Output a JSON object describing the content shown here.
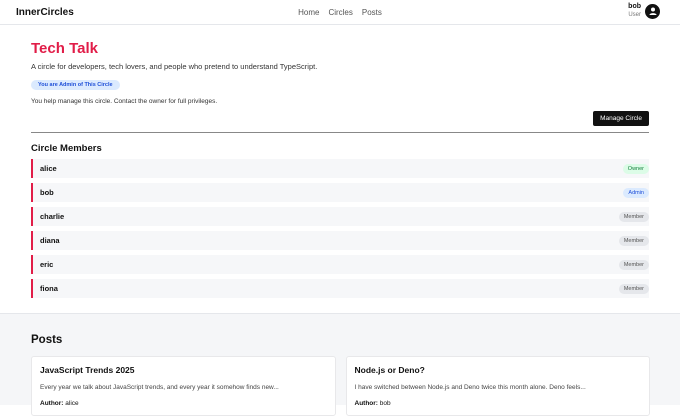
{
  "header": {
    "brand": "InnerCircles",
    "nav": [
      "Home",
      "Circles",
      "Posts"
    ],
    "user": {
      "name": "bob",
      "role": "User"
    }
  },
  "circle": {
    "title": "Tech Talk",
    "description": "A circle for developers, tech lovers, and people who pretend to understand TypeScript.",
    "admin_badge": "You are Admin of This Circle",
    "help_text": "You help manage this circle. Contact the owner for full privileges.",
    "manage_button": "Manage Circle"
  },
  "members": {
    "title": "Circle Members",
    "items": [
      {
        "name": "alice",
        "role": "Owner"
      },
      {
        "name": "bob",
        "role": "Admin"
      },
      {
        "name": "charlie",
        "role": "Member"
      },
      {
        "name": "diana",
        "role": "Member"
      },
      {
        "name": "eric",
        "role": "Member"
      },
      {
        "name": "fiona",
        "role": "Member"
      }
    ]
  },
  "posts": {
    "title": "Posts",
    "author_label": "Author:",
    "items": [
      {
        "title": "JavaScript Trends 2025",
        "excerpt": "Every year we talk about JavaScript trends, and every year it somehow finds new...",
        "author": "alice"
      },
      {
        "title": "Node.js or Deno?",
        "excerpt": "I have switched between Node.js and Deno twice this month alone. Deno feels...",
        "author": "bob"
      }
    ]
  },
  "colors": {
    "accent": "#e11d48",
    "owner": "#15803d",
    "admin": "#1d4ed8"
  }
}
